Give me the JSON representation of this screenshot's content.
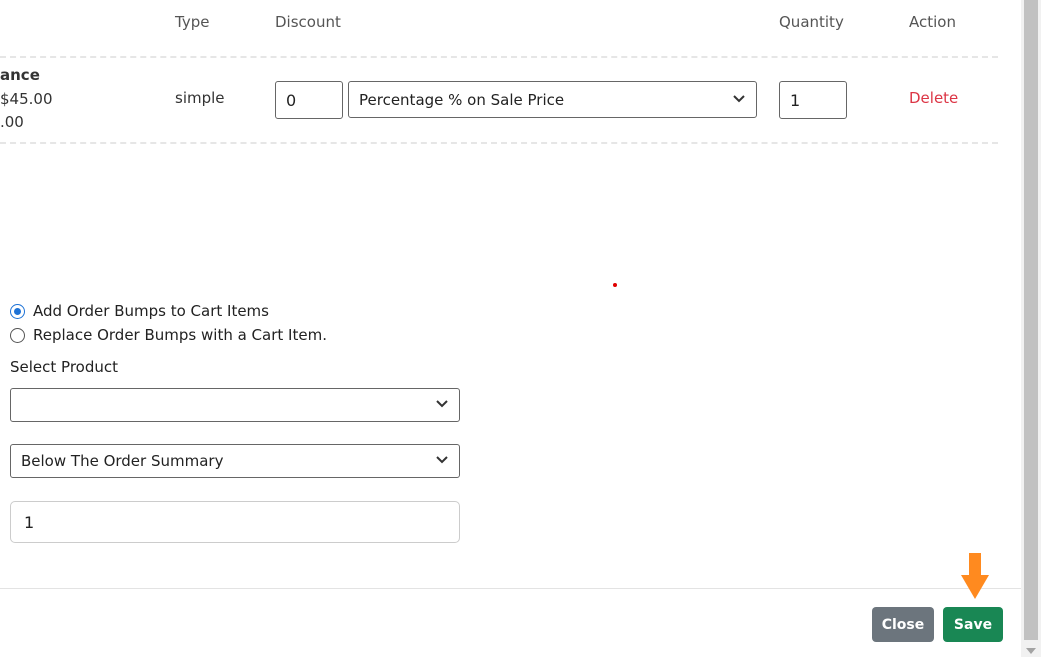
{
  "table": {
    "headers": {
      "type": "Type",
      "discount": "Discount",
      "quantity": "Quantity",
      "action": "Action"
    },
    "row": {
      "name_fragment": "ance",
      "price_fragment": "$45.00",
      "price_fragment2": ".00",
      "type": "simple",
      "discount_value": "0",
      "discount_type": "Percentage % on Sale Price",
      "quantity": "1",
      "action": "Delete"
    }
  },
  "bump_mode": {
    "options": [
      {
        "label": "Add Order Bumps to Cart Items",
        "selected": true
      },
      {
        "label": "Replace Order Bumps with a Cart Item.",
        "selected": false
      }
    ]
  },
  "select_product": {
    "label": "Select Product",
    "value": ""
  },
  "position_select": {
    "value": "Below The Order Summary"
  },
  "count_input": {
    "value": "1"
  },
  "footer": {
    "close_label": "Close",
    "save_label": "Save"
  },
  "colors": {
    "accent": "#1d72d6",
    "delete": "#dc3545",
    "save": "#198754",
    "close": "#6c757d",
    "arrow": "#ff8a1f"
  }
}
